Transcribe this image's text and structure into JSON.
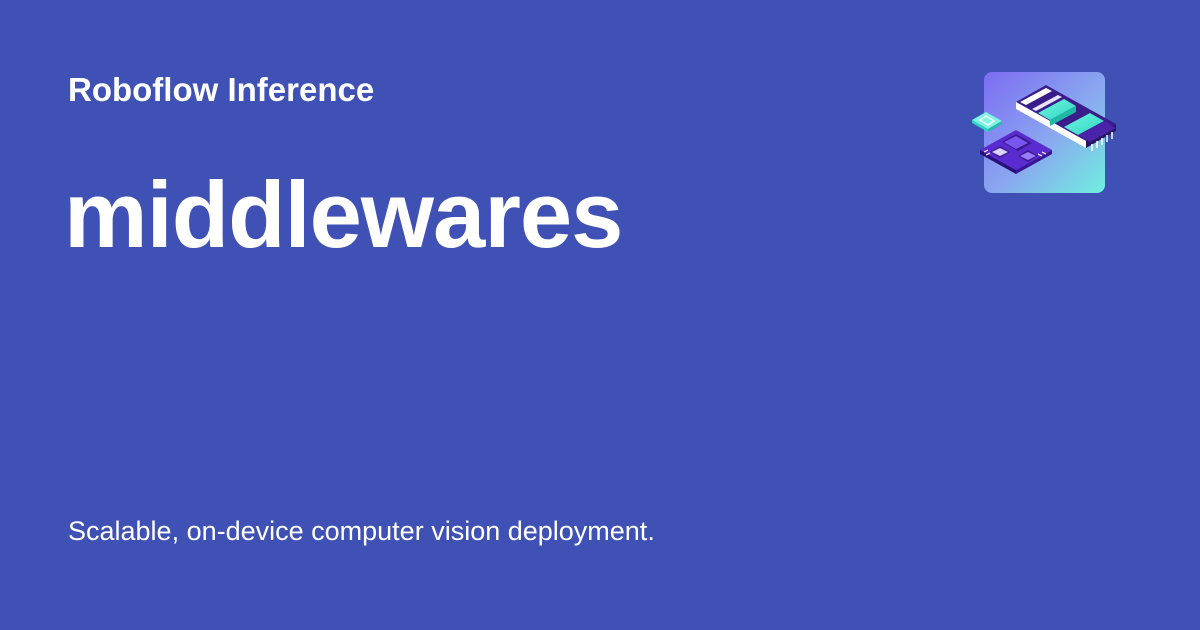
{
  "card": {
    "site_name": "Roboflow Inference",
    "title": "middlewares",
    "description": "Scalable, on-device computer vision deployment.",
    "background_color": "#3f51b5",
    "text_color": "#ffffff"
  },
  "logo": {
    "icon": "inference-hardware-logo-icon",
    "gradient_start": "#7c4dff",
    "gradient_end": "#64ffda"
  }
}
